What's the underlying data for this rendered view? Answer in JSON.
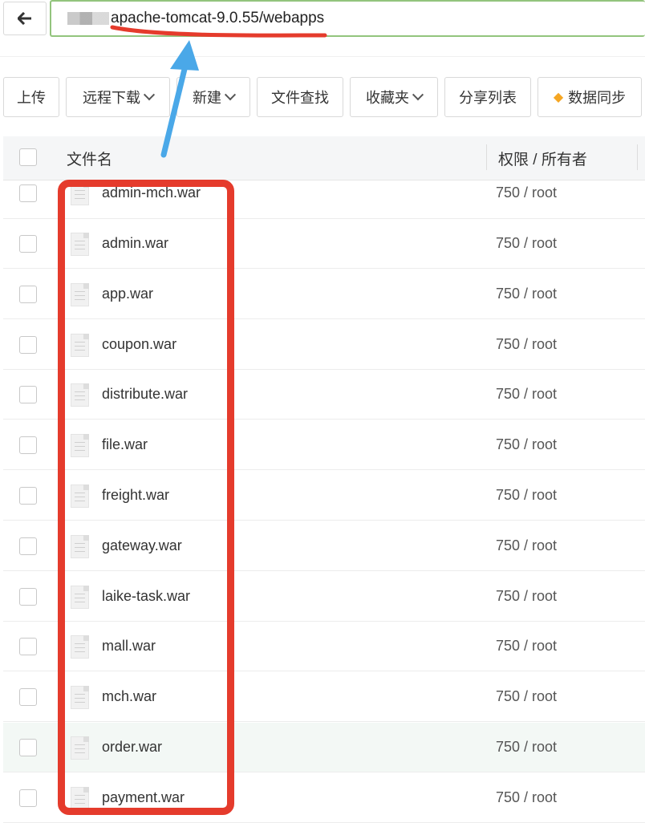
{
  "address_bar": {
    "path_suffix": "apache-tomcat-9.0.55/webapps",
    "back_icon": "arrow-left-icon"
  },
  "toolbar": [
    {
      "label": "上传",
      "dropdown": false
    },
    {
      "label": "远程下载",
      "dropdown": true
    },
    {
      "label": "新建",
      "dropdown": true
    },
    {
      "label": "文件查找",
      "dropdown": false
    },
    {
      "label": "收藏夹",
      "dropdown": true
    },
    {
      "label": "分享列表",
      "dropdown": false
    },
    {
      "label": "数据同步",
      "dropdown": false,
      "icon": "diamond-icon"
    }
  ],
  "table": {
    "col_name": "文件名",
    "col_perm": "权限 / 所有者",
    "rows": [
      {
        "name": "admin-mch.war",
        "perm": "750 / root"
      },
      {
        "name": "admin.war",
        "perm": "750 / root"
      },
      {
        "name": "app.war",
        "perm": "750 / root"
      },
      {
        "name": "coupon.war",
        "perm": "750 / root"
      },
      {
        "name": "distribute.war",
        "perm": "750 / root"
      },
      {
        "name": "file.war",
        "perm": "750 / root"
      },
      {
        "name": "freight.war",
        "perm": "750 / root"
      },
      {
        "name": "gateway.war",
        "perm": "750 / root"
      },
      {
        "name": "laike-task.war",
        "perm": "750 / root"
      },
      {
        "name": "mall.war",
        "perm": "750 / root"
      },
      {
        "name": "mch.war",
        "perm": "750 / root"
      },
      {
        "name": "order.war",
        "perm": "750 / root"
      },
      {
        "name": "payment.war",
        "perm": "750 / root"
      }
    ]
  },
  "colors": {
    "annotation_red": "#e53b2c",
    "annotation_blue": "#4aa8e8",
    "path_border": "#93c47d",
    "gem": "#f5a623"
  }
}
